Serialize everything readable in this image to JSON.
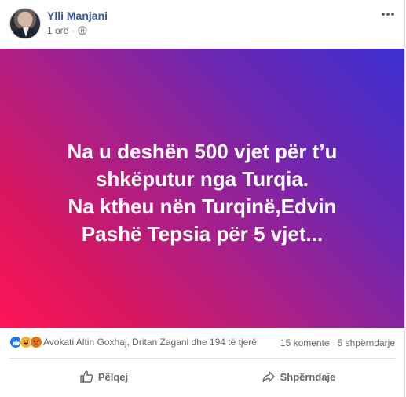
{
  "post": {
    "author": "Ylli Manjani",
    "time": "1 orë",
    "separator": "·",
    "more_icon": "more-horizontal-icon",
    "visibility_icon": "globe-icon",
    "image_text_lines": [
      "Na u deshën 500 vjet për t’u",
      "shkëputur nga Turqia.",
      "Na ktheu nën Turqinë,Edvin",
      "Pashë Tepsia për 5 vjet..."
    ],
    "gradient_colors": [
      "#ff1457",
      "#a8208a",
      "#3c2fd0"
    ]
  },
  "reactions": {
    "icons": [
      "like-react-icon",
      "haha-react-icon",
      "angry-react-icon"
    ],
    "summary": "Avokati Altin Goxhaj, Dritan Zagani dhe 194 të tjerë",
    "comments": "15 komente",
    "shares": "5 shpërndarje"
  },
  "actions": {
    "like_label": "Pëlqej",
    "share_label": "Shpërndaje"
  },
  "colors": {
    "author_link": "#385898",
    "meta_gray": "#616770",
    "like_blue": "#1877f2"
  }
}
